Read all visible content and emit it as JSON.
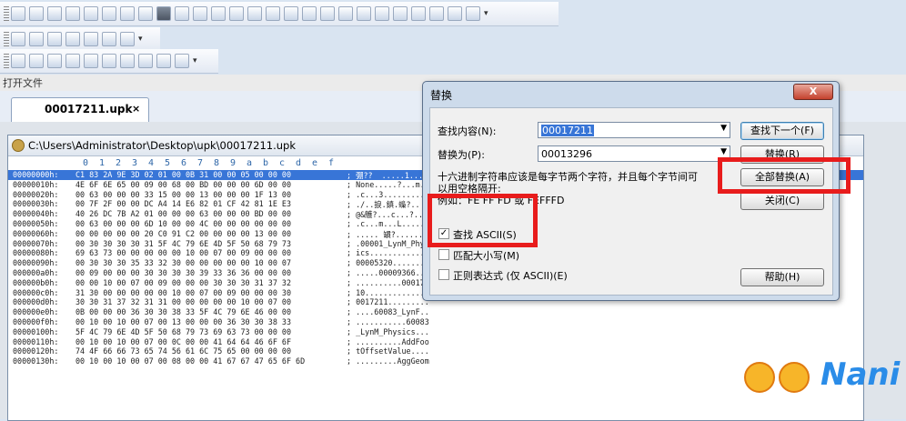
{
  "toolbars": {
    "row1_icons": [
      "list-icon",
      "bold-icon",
      "italic-icon",
      "underline-icon",
      "table-icon",
      "table-icon",
      "table-icon",
      "table-icon",
      "color-icon",
      "table-icon",
      "table-icon",
      "table-icon",
      "table-icon",
      "square-icon",
      "window-icon",
      "window-icon",
      "window-icon",
      "window-icon",
      "window-icon",
      "checkbox-icon",
      "radio-icon",
      "image-icon",
      "anchor-icon",
      "image-icon",
      "image-icon",
      "form-icon"
    ],
    "row2_icons": [
      "globe-icon",
      "page-icon",
      "download-icon",
      "check-icon",
      "window-icon",
      "wand-icon",
      "page-icon"
    ],
    "row3_icons": [
      "google-icon",
      "yahoo-icon",
      "wikipedia-icon",
      "search-icon",
      "flag-icon",
      "folder-icon",
      "share-icon",
      "php-icon",
      "windows-icon",
      "page-icon"
    ]
  },
  "open_file_label": "打开文件",
  "tab": {
    "label": "00017211.upk",
    "close": "×"
  },
  "editor": {
    "title": "C:\\Users\\Administrator\\Desktop\\upk\\00017211.upk",
    "columns": [
      "0",
      "1",
      "2",
      "3",
      "4",
      "5",
      "6",
      "7",
      "8",
      "9",
      "a",
      "b",
      "c",
      "d",
      "e",
      "f"
    ],
    "rows": [
      {
        "offset": "00000000h:",
        "bytes": "C1 83 2A 9E 3D 02 01 00 0B 31 00 00 05 00 00 00",
        "ascii": "; 弸??  .....1......"
      },
      {
        "offset": "00000010h:",
        "bytes": "4E 6F 6E 65 00 09 00 68 00 BD 00 00 00 6D 00 00",
        "ascii": "; None.....?...m.."
      },
      {
        "offset": "00000020h:",
        "bytes": "00 63 00 00 00 33 15 00 00 13 00 00 00 1F 13 00",
        "ascii": "; .c...3.........."
      },
      {
        "offset": "00000030h:",
        "bytes": "00 7F 2F 00 00 DC A4 14 E6 82 01 CF 42 81 1E E3",
        "ascii": "; ./..捩.鎮.蟂?.."
      },
      {
        "offset": "00000040h:",
        "bytes": "40 26 DC 7B A2 01 00 00 00 63 00 00 00 BD 00 00",
        "ascii": "; @&鸌?...c...?.."
      },
      {
        "offset": "00000050h:",
        "bytes": "00 63 00 00 00 6D 10 00 00 4C 00 00 00 00 00 00",
        "ascii": "; .c...m...L......"
      },
      {
        "offset": "00000060h:",
        "bytes": "00 00 00 00 00 20 C0 91 C2 00 00 00 00 13 00 00",
        "ascii": "; ..... 罆?........"
      },
      {
        "offset": "00000070h:",
        "bytes": "00 30 30 30 30 31 5F 4C 79 6E 4D 5F 50 68 79 73",
        "ascii": "; .00001_LynM_Phys"
      },
      {
        "offset": "00000080h:",
        "bytes": "69 63 73 00 00 00 00 00 10 00 07 00 09 00 00 00",
        "ascii": "; ics............"
      },
      {
        "offset": "00000090h:",
        "bytes": "00 30 30 30 35 33 32 30 00 00 00 00 00 10 00 07",
        "ascii": "; 00005320........"
      },
      {
        "offset": "000000a0h:",
        "bytes": "00 09 00 00 00 30 30 30 30 39 33 36 36 00 00 00",
        "ascii": "; .....00009366..."
      },
      {
        "offset": "000000b0h:",
        "bytes": "00 00 10 00 07 00 09 00 00 00 30 30 30 31 37 32",
        "ascii": "; ..........000172"
      },
      {
        "offset": "000000c0h:",
        "bytes": "31 30 00 00 00 00 00 10 00 07 00 09 00 00 00 30",
        "ascii": "; 10..............0"
      },
      {
        "offset": "000000d0h:",
        "bytes": "30 30 31 37 32 31 31 00 00 00 00 00 10 00 07 00",
        "ascii": "; 0017211........."
      },
      {
        "offset": "000000e0h:",
        "bytes": "0B 00 00 00 36 30 30 38 33 5F 4C 79 6E 46 00 00",
        "ascii": "; ....60083_LynF.."
      },
      {
        "offset": "000000f0h:",
        "bytes": "00 10 00 10 00 07 00 13 00 00 00 36 30 30 38 33",
        "ascii": "; ...........60083"
      },
      {
        "offset": "00000100h:",
        "bytes": "5F 4C 79 6E 4D 5F 50 68 79 73 69 63 73 00 00 00",
        "ascii": "; _LynM_Physics..."
      },
      {
        "offset": "00000110h:",
        "bytes": "00 10 00 10 00 07 00 0C 00 00 41 64 64 46 6F 6F",
        "ascii": "; ..........AddFoo"
      },
      {
        "offset": "00000120h:",
        "bytes": "74 4F 66 66 73 65 74 56 61 6C 75 65 00 00 00 00",
        "ascii": "; tOffsetValue...."
      },
      {
        "offset": "00000130h:",
        "bytes": "00 10 00 10 00 07 00 08 00 00 41 67 67 47 65 6F 6D",
        "ascii": "; .........AggGeom"
      }
    ]
  },
  "dialog": {
    "title": "替换",
    "close_glyph": "X",
    "find_label": "查找内容(N):",
    "find_value": "00017211",
    "replace_label": "替换为(P):",
    "replace_value": "00013296",
    "hint_line1": "十六进制字符串应该是每字节两个字符，并且每个字节间可",
    "hint_line2": "以用空格隔开:",
    "hint_line3": "例如：FE FF FD 或 FEFFFD",
    "opt_ascii": "查找 ASCII(S)",
    "opt_case": "匹配大小写(M)",
    "opt_regex": "正则表达式 (仅 ASCII)(E)",
    "btn_find_next": "查找下一个(F)",
    "btn_replace": "替换(R)",
    "btn_replace_all": "全部替换(A)",
    "btn_close": "关闭(C)",
    "btn_help": "帮助(H)"
  },
  "watermark": {
    "text": "Nani"
  },
  "colors": {
    "highlight": "#e81c1c",
    "selection": "#3875d7"
  }
}
